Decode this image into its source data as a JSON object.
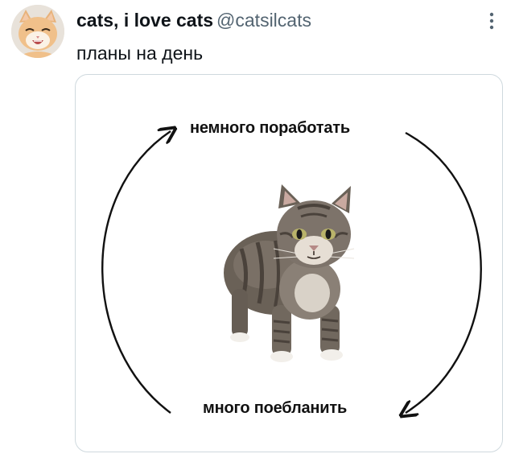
{
  "tweet": {
    "author": {
      "display_name": "cats, i love cats",
      "handle": "@catsilcats",
      "avatar_icon": "cat-avatar"
    },
    "more_icon": "vertical-ellipsis-icon",
    "text": "планы на день"
  },
  "media": {
    "top_label": "немного поработать",
    "bottom_label": "много поебланить",
    "arrows": "cycle-arrows",
    "image_subject": "cat-photo"
  },
  "colors": {
    "text_primary": "#0f1419",
    "text_secondary": "#536471",
    "card_border": "#cfd9de",
    "arrow": "#111111"
  }
}
